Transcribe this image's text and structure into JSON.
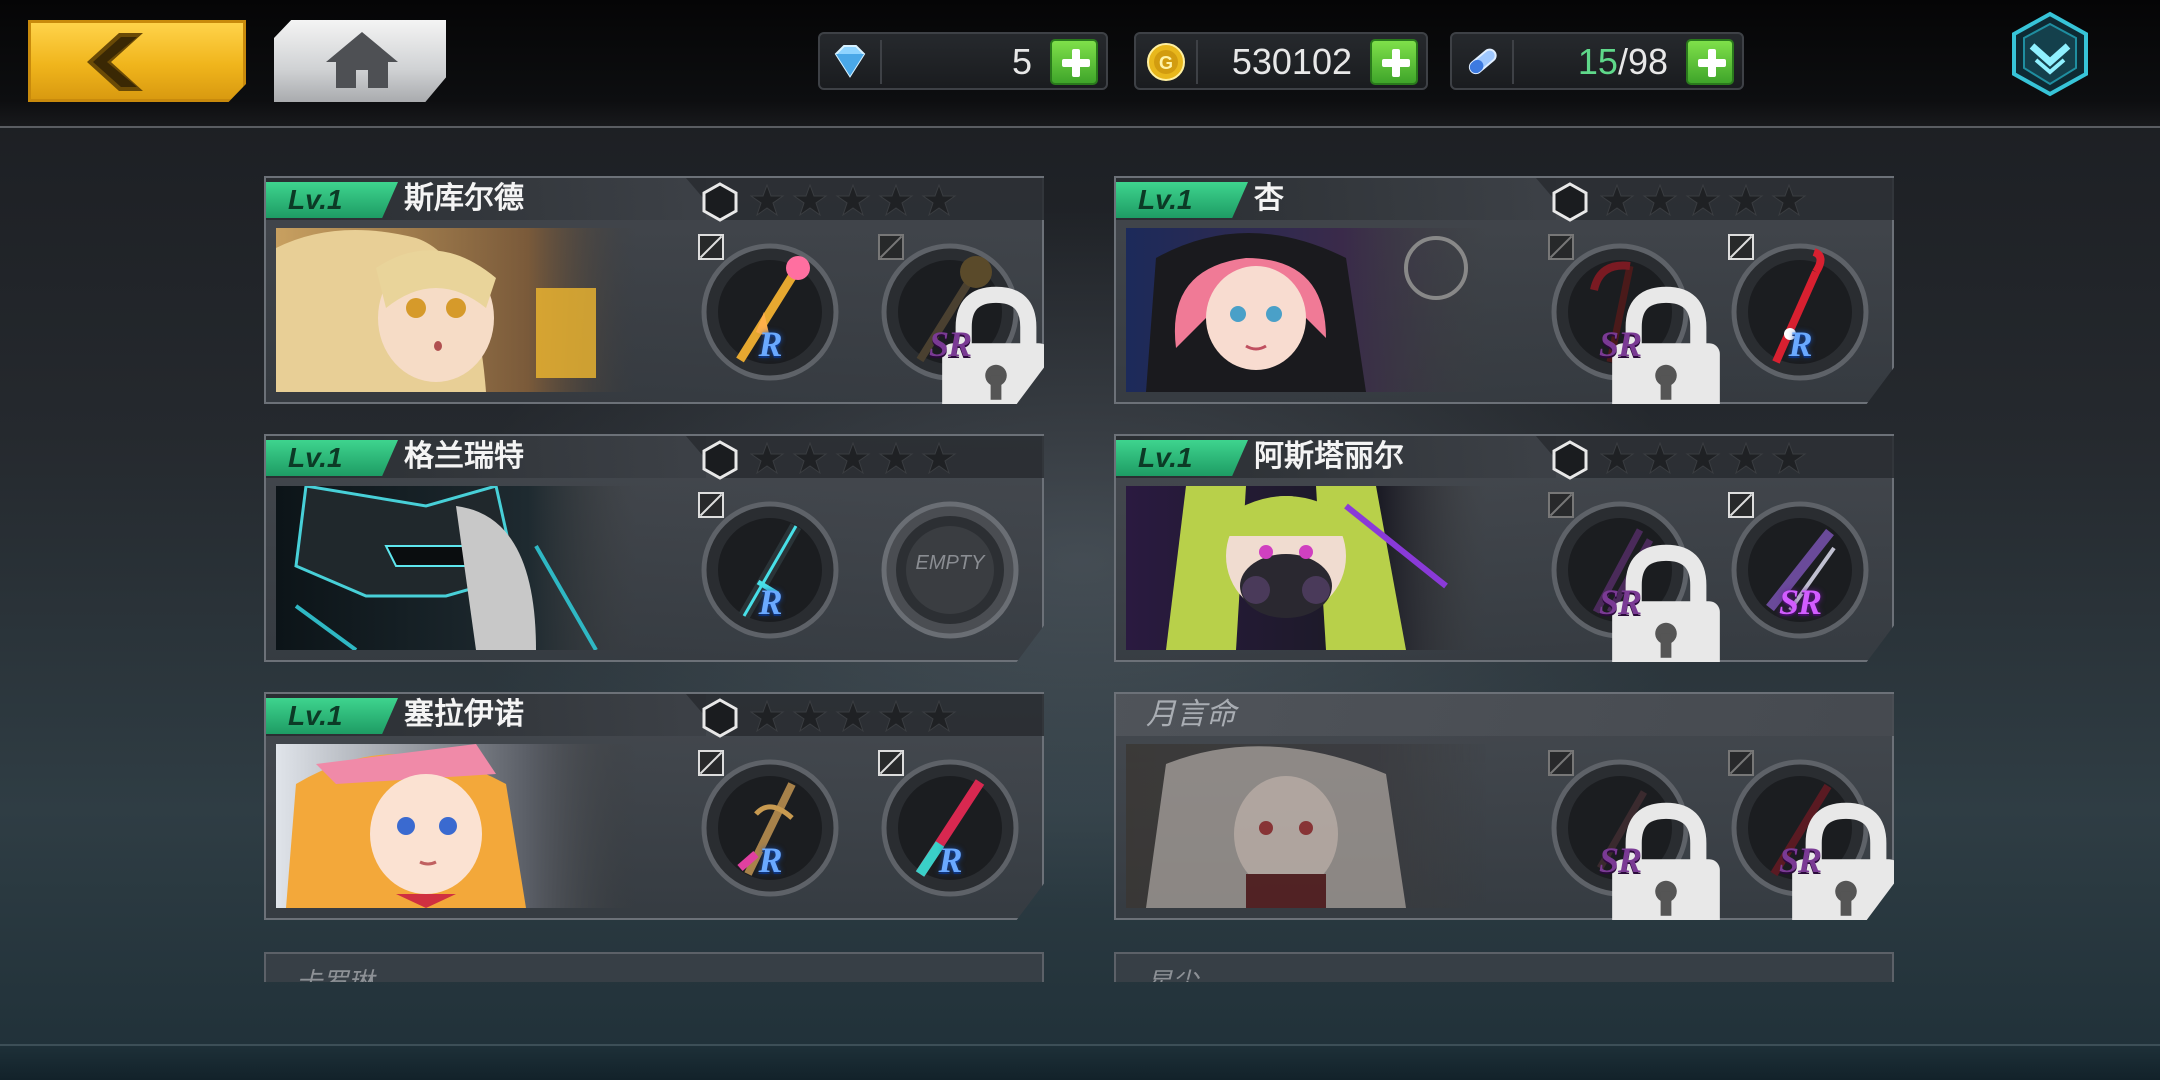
{
  "topbar": {
    "back_icon": "chevron-left-icon",
    "home_icon": "home-icon",
    "menu_icon": "chevron-down-badge-icon",
    "resources": [
      {
        "icon": "diamond-icon",
        "value": "5"
      },
      {
        "icon": "gold-coin-icon",
        "value": "530102"
      },
      {
        "icon": "stamina-vial-icon",
        "current": "15",
        "max": "/98"
      }
    ]
  },
  "cards": [
    {
      "level": "Lv.1",
      "name": "斯库尔德",
      "stars": 5,
      "unlocked": true,
      "weapons": [
        {
          "rarity": "R",
          "locked": false,
          "type": "staff"
        },
        {
          "rarity": "SR",
          "locked": true,
          "type": "scepter"
        }
      ]
    },
    {
      "level": "Lv.1",
      "name": "杏",
      "stars": 5,
      "unlocked": true,
      "weapons": [
        {
          "rarity": "SR",
          "locked": true,
          "type": "scythe"
        },
        {
          "rarity": "R",
          "locked": false,
          "type": "cane"
        }
      ]
    },
    {
      "level": "Lv.1",
      "name": "格兰瑞特",
      "stars": 5,
      "unlocked": true,
      "weapons": [
        {
          "rarity": "R",
          "locked": false,
          "type": "sword"
        },
        {
          "rarity": "",
          "locked": false,
          "empty": true,
          "type": "empty",
          "empty_label": "EMPTY"
        }
      ]
    },
    {
      "level": "Lv.1",
      "name": "阿斯塔丽尔",
      "stars": 5,
      "unlocked": true,
      "weapons": [
        {
          "rarity": "SR",
          "locked": true,
          "type": "claw"
        },
        {
          "rarity": "SR",
          "locked": false,
          "type": "gun"
        }
      ]
    },
    {
      "level": "Lv.1",
      "name": "塞拉伊诺",
      "stars": 5,
      "unlocked": true,
      "weapons": [
        {
          "rarity": "R",
          "locked": false,
          "type": "anchor-sword"
        },
        {
          "rarity": "R",
          "locked": false,
          "type": "spear"
        }
      ]
    },
    {
      "level": "",
      "name": "月言命",
      "stars": 0,
      "unlocked": false,
      "weapons": [
        {
          "rarity": "SR",
          "locked": true,
          "type": "chain"
        },
        {
          "rarity": "SR",
          "locked": true,
          "type": "blade"
        }
      ]
    }
  ],
  "partial_cards": [
    {
      "name": "卡罗琳"
    },
    {
      "name": "星尘"
    }
  ],
  "colors": {
    "level_badge": "#2fbf7c",
    "r_rarity": "#6aa9ff",
    "sr_rarity": "#d25cff",
    "back_button": "#f2b820"
  }
}
